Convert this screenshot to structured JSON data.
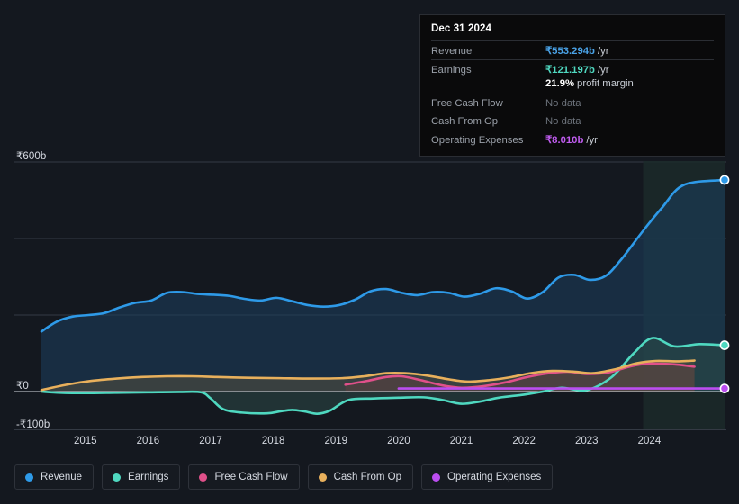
{
  "tooltip": {
    "title": "Dec 31 2024",
    "rows": [
      {
        "label": "Revenue",
        "value": "₹553.294b",
        "suffix": "/yr",
        "color": "#4aa3e8"
      },
      {
        "label": "Earnings",
        "value": "₹121.197b",
        "suffix": "/yr",
        "color": "#4fd8c0"
      },
      {
        "label": "",
        "value": "21.9%",
        "suffix": "profit margin",
        "color": "#ffffff"
      },
      {
        "label": "Free Cash Flow",
        "value": "No data",
        "suffix": "",
        "color": "#6d737c"
      },
      {
        "label": "Cash From Op",
        "value": "No data",
        "suffix": "",
        "color": "#6d737c"
      },
      {
        "label": "Operating Expenses",
        "value": "₹8.010b",
        "suffix": "/yr",
        "color": "#c05cf0"
      }
    ]
  },
  "legend": {
    "items": [
      {
        "label": "Revenue",
        "color": "#2e9ae8"
      },
      {
        "label": "Earnings",
        "color": "#4fd8c0"
      },
      {
        "label": "Free Cash Flow",
        "color": "#e0508a"
      },
      {
        "label": "Cash From Op",
        "color": "#e8b05c"
      },
      {
        "label": "Operating Expenses",
        "color": "#bb4df0"
      }
    ]
  },
  "chart_data": {
    "type": "area",
    "title": "",
    "xlabel": "",
    "ylabel": "",
    "ylim": [
      -100,
      600
    ],
    "y_unit": "b",
    "currency": "₹",
    "grid": true,
    "legend_position": "bottom",
    "y_ticks": [
      600,
      0,
      -100
    ],
    "y_tick_labels": [
      "₹600b",
      "₹0",
      "-₹100b"
    ],
    "y_gridlines": [
      600,
      400,
      200,
      0,
      -100
    ],
    "x_ticks": [
      "2015",
      "2016",
      "2017",
      "2018",
      "2019",
      "2020",
      "2021",
      "2022",
      "2023",
      "2024"
    ],
    "x_range": [
      2014.3,
      2025.2
    ],
    "forecast_start": "2023.9",
    "series": [
      {
        "name": "Revenue",
        "color": "#2e9ae8",
        "fill": "#1b3f5e",
        "x": [
          2014.3,
          2014.55,
          2014.8,
          2015.05,
          2015.3,
          2015.55,
          2015.8,
          2016.05,
          2016.3,
          2016.55,
          2016.8,
          2017.05,
          2017.3,
          2017.55,
          2017.8,
          2018.05,
          2018.3,
          2018.55,
          2018.8,
          2019.05,
          2019.3,
          2019.55,
          2019.8,
          2020.05,
          2020.3,
          2020.55,
          2020.8,
          2021.05,
          2021.3,
          2021.55,
          2021.8,
          2022.05,
          2022.3,
          2022.55,
          2022.8,
          2023.05,
          2023.3,
          2023.55,
          2023.9,
          2024.2,
          2024.55,
          2025.2
        ],
        "values": [
          157,
          183,
          196,
          200,
          205,
          220,
          232,
          238,
          258,
          260,
          255,
          253,
          250,
          242,
          238,
          245,
          236,
          226,
          222,
          226,
          240,
          262,
          268,
          258,
          252,
          260,
          258,
          248,
          256,
          270,
          262,
          243,
          260,
          298,
          305,
          292,
          302,
          345,
          420,
          480,
          540,
          553
        ]
      },
      {
        "name": "Earnings",
        "color": "#4fd8c0",
        "fill": "#2c4a47",
        "x": [
          2014.3,
          2014.6,
          2015.0,
          2015.5,
          2016.0,
          2016.5,
          2016.85,
          2017.0,
          2017.2,
          2017.5,
          2017.9,
          2018.1,
          2018.3,
          2018.5,
          2018.7,
          2018.9,
          2019.2,
          2019.6,
          2020.0,
          2020.4,
          2020.7,
          2021.0,
          2021.3,
          2021.6,
          2022.0,
          2022.3,
          2022.6,
          2023.0,
          2023.4,
          2023.75,
          2024.05,
          2024.4,
          2024.8,
          2025.2
        ],
        "values": [
          0,
          -3,
          -4,
          -3,
          -2,
          -1,
          -2,
          -18,
          -46,
          -55,
          -57,
          -52,
          -48,
          -52,
          -58,
          -50,
          -22,
          -18,
          -16,
          -15,
          -22,
          -32,
          -26,
          -16,
          -8,
          0,
          10,
          4,
          38,
          100,
          140,
          118,
          124,
          121
        ]
      },
      {
        "name": "Free Cash Flow",
        "color": "#e0508a",
        "fill": "#5e2f42",
        "x": [
          2019.15,
          2019.5,
          2019.8,
          2020.05,
          2020.35,
          2020.7,
          2021.0,
          2021.35,
          2021.7,
          2022.05,
          2022.4,
          2022.7,
          2023.0,
          2023.35,
          2023.7,
          2024.0,
          2024.4,
          2024.72
        ],
        "values": [
          18,
          28,
          38,
          40,
          30,
          16,
          10,
          14,
          24,
          38,
          48,
          52,
          46,
          50,
          66,
          73,
          71,
          65
        ]
      },
      {
        "name": "Cash From Op",
        "color": "#e8b05c",
        "fill": "#55513f",
        "x": [
          2014.3,
          2014.7,
          2015.1,
          2015.5,
          2015.9,
          2016.3,
          2016.7,
          2017.1,
          2017.6,
          2018.1,
          2018.6,
          2019.1,
          2019.45,
          2019.8,
          2020.1,
          2020.45,
          2020.8,
          2021.1,
          2021.45,
          2021.8,
          2022.1,
          2022.45,
          2022.8,
          2023.1,
          2023.45,
          2023.8,
          2024.1,
          2024.45,
          2024.72
        ],
        "values": [
          4,
          18,
          28,
          34,
          38,
          40,
          40,
          38,
          36,
          35,
          34,
          35,
          40,
          48,
          48,
          42,
          32,
          26,
          30,
          38,
          48,
          54,
          52,
          48,
          58,
          74,
          80,
          79,
          81
        ]
      },
      {
        "name": "Operating Expenses",
        "color": "#bb4df0",
        "fill": "none",
        "x": [
          2020.0,
          2025.2
        ],
        "values": [
          8,
          8
        ]
      }
    ]
  }
}
